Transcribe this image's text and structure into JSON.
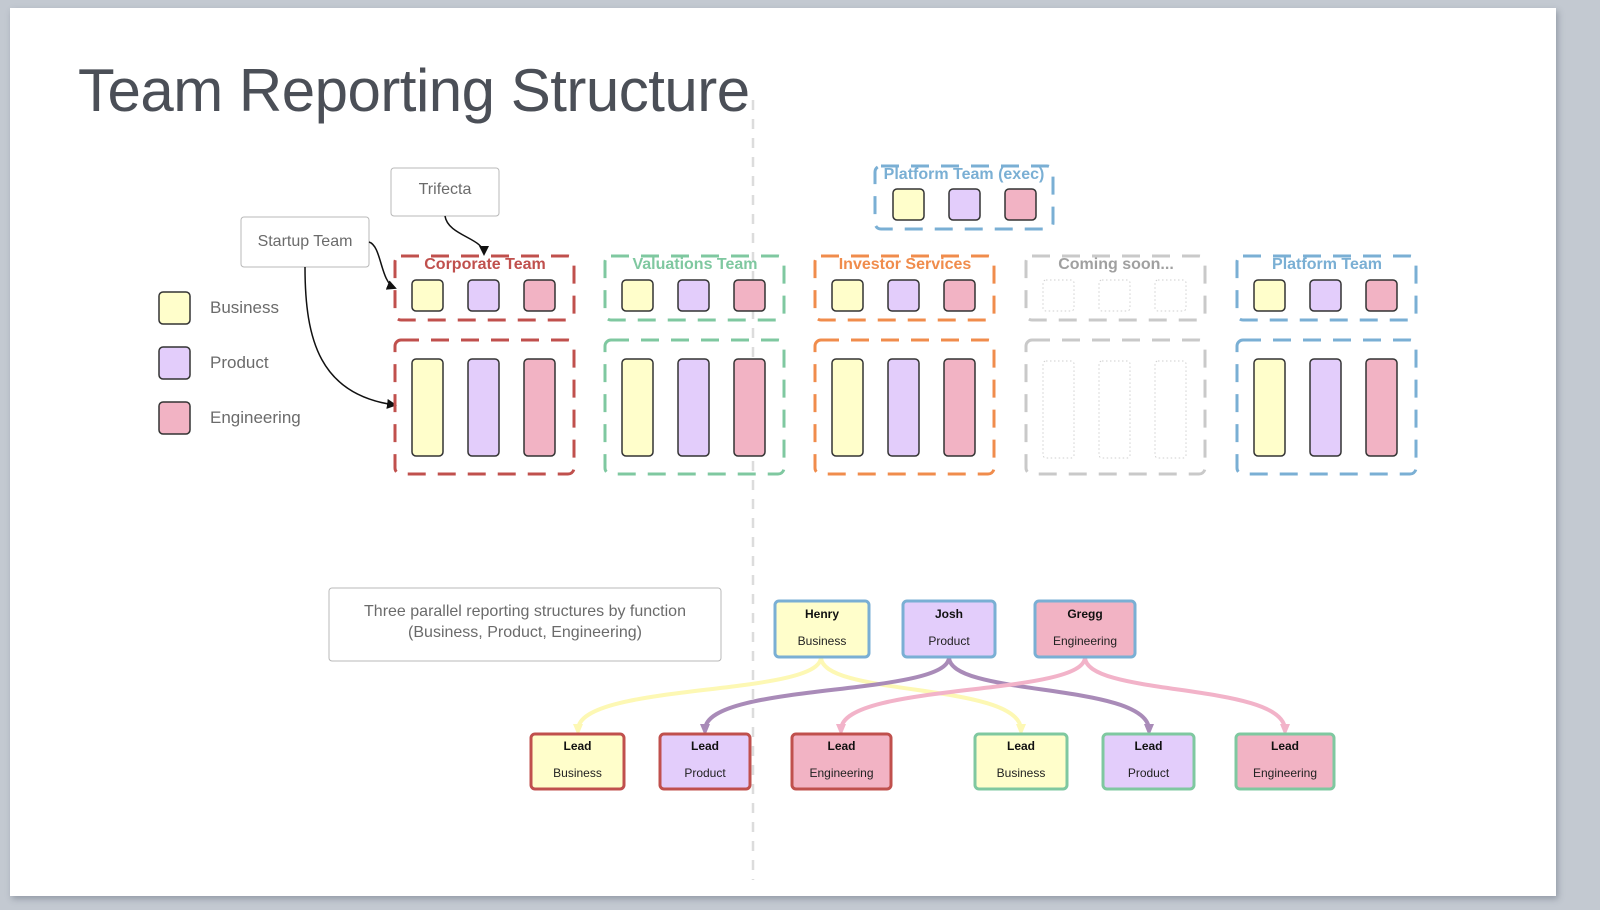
{
  "slide": {
    "title": "Team Reporting Structure"
  },
  "colors": {
    "business": "#fffecb",
    "product": "#e3cdfb",
    "engineering": "#f2b3c4",
    "outline": "#333333",
    "text_gray": "#6b6b6b",
    "divider": "#dcdcdc"
  },
  "legend": [
    {
      "key": "business",
      "label": "Business"
    },
    {
      "key": "product",
      "label": "Product"
    },
    {
      "key": "engineering",
      "label": "Engineering"
    }
  ],
  "callouts": {
    "trifecta": "Trifecta",
    "startup_team": "Startup Team",
    "parallel_note_line1": "Three parallel reporting structures by function",
    "parallel_note_line2": "(Business, Product, Engineering)"
  },
  "teams": [
    {
      "name": "Corporate Team",
      "color": "#c0504d",
      "placeholder": false
    },
    {
      "name": "Valuations Team",
      "color": "#7fc8a0",
      "placeholder": false
    },
    {
      "name": "Investor Services",
      "color": "#f08c4c",
      "placeholder": false
    },
    {
      "name": "Coming soon...",
      "color": "#c9c9c9",
      "label_color": "#a0a0a0",
      "placeholder": true
    },
    {
      "name": "Platform Team",
      "color": "#7aafd4",
      "placeholder": false
    }
  ],
  "exec_team": {
    "name": "Platform Team (exec)",
    "color": "#7aafd4"
  },
  "heads": [
    {
      "name": "Henry",
      "role": "Business",
      "key": "business",
      "border": "#7aafd4"
    },
    {
      "name": "Josh",
      "role": "Product",
      "key": "product",
      "border": "#7aafd4"
    },
    {
      "name": "Gregg",
      "role": "Engineering",
      "key": "engineering",
      "border": "#7aafd4"
    }
  ],
  "leads": [
    {
      "name": "Lead",
      "role": "Business",
      "key": "business",
      "border": "#c0504d"
    },
    {
      "name": "Lead",
      "role": "Product",
      "key": "product",
      "border": "#c0504d"
    },
    {
      "name": "Lead",
      "role": "Engineering",
      "key": "engineering",
      "border": "#c0504d"
    },
    {
      "name": "Lead",
      "role": "Business",
      "key": "business",
      "border": "#7fc8a0"
    },
    {
      "name": "Lead",
      "role": "Product",
      "key": "product",
      "border": "#7fc8a0"
    },
    {
      "name": "Lead",
      "role": "Engineering",
      "key": "engineering",
      "border": "#7fc8a0"
    }
  ],
  "connectors": {
    "business": "#fdf8b4",
    "product": "#a98bb8",
    "engineering": "#f2b3c9"
  }
}
